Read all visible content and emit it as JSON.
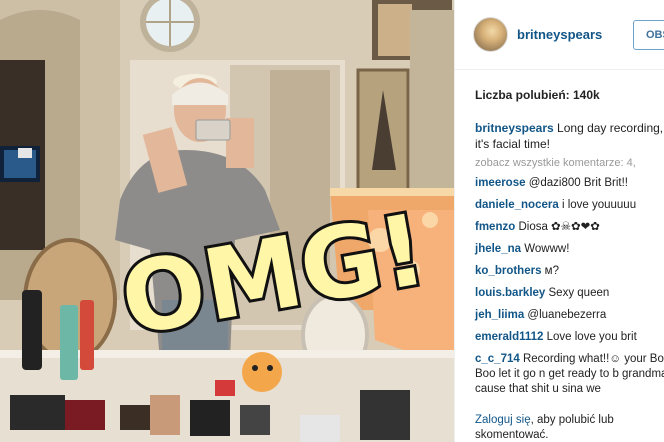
{
  "post": {
    "overlay_text": "OMG!"
  },
  "header": {
    "username": "britneyspears",
    "follow_label": "OBS"
  },
  "likes": {
    "label": "Liczba polubień: 140k"
  },
  "caption": {
    "username": "britneyspears",
    "text_line1": "Long day recording,",
    "text_line2": "it's facial time!"
  },
  "see_all": "zobacz wszystkie komentarze: 4,",
  "comments": [
    {
      "username": "imeerose",
      "text": "@dazi800 Brit Brit!!"
    },
    {
      "username": "daniele_nocera",
      "text": "i love youuuuu"
    },
    {
      "username": "fmenzo",
      "text": "Diosa ✿☠✿❤✿"
    },
    {
      "username": "jhele_na",
      "text": "Wowww!"
    },
    {
      "username": "ko_brothers",
      "text": "м?"
    },
    {
      "username": "louis.barkley",
      "text": "Sexy queen"
    },
    {
      "username": "jeh_liima",
      "text": "@luanebezerra"
    },
    {
      "username": "emerald1112",
      "text": "Love love you brit"
    },
    {
      "username": "c_c_714",
      "text": "Recording what!!☺ your Boo Boo let it go n get ready to b grandma cause that shit u sina we"
    }
  ],
  "login": {
    "link": "Zaloguj się",
    "text": ", aby polubić lub skomentować."
  },
  "colors": {
    "username": "#125688",
    "button_border": "#6fa2c9",
    "omg_fill": "#fff6a8",
    "omg_stroke": "#111111"
  }
}
